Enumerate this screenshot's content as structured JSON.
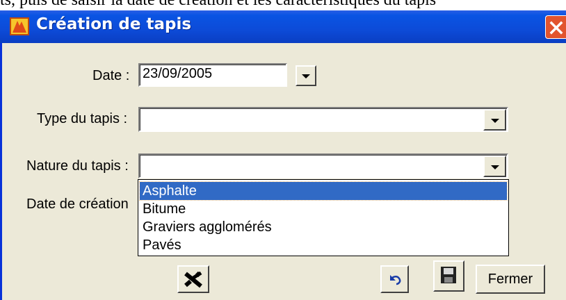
{
  "document": {
    "caption": "ts, puis de saisir la date de création et les caractéristiques du tapis"
  },
  "window": {
    "title": "Création de tapis"
  },
  "form": {
    "date_label": "Date :",
    "date_value": "23/09/2005",
    "type_label": "Type du tapis :",
    "type_value": "",
    "nature_label": "Nature du tapis :",
    "nature_value": "",
    "creation_label": "Date de création"
  },
  "dropdown": {
    "items": [
      "Asphalte",
      "Bitume",
      "Graviers agglomérés",
      "Pavés"
    ],
    "selected": "Asphalte"
  },
  "buttons": {
    "close_label": "Fermer"
  },
  "icons": {
    "app": "app-icon",
    "close": "close-icon",
    "delete": "delete-icon",
    "undo": "undo-icon",
    "save": "save-icon"
  },
  "colors": {
    "titlebar": "#0a54e3",
    "window": "#ece9d8",
    "selection": "#316ac5",
    "close": "#e2542e"
  }
}
